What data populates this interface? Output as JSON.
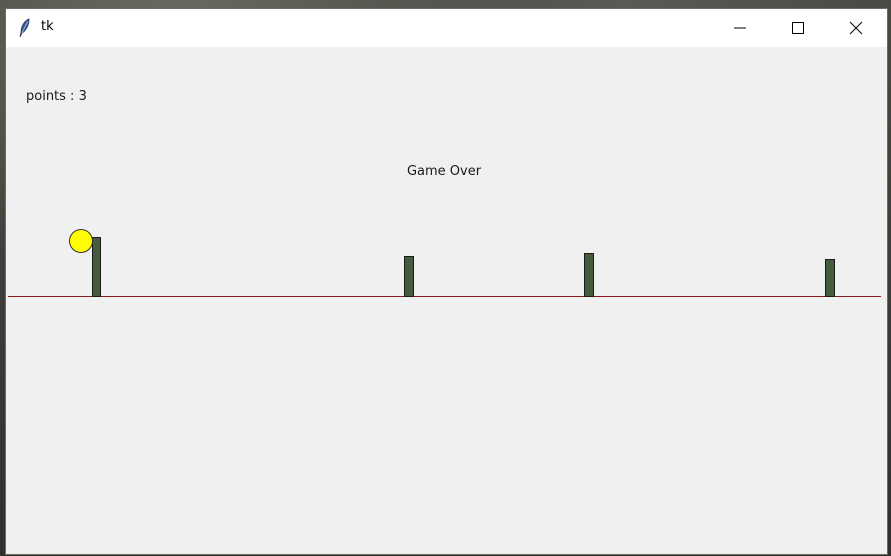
{
  "window": {
    "title": "tk",
    "minimize_icon": "minimize-icon",
    "maximize_icon": "maximize-icon",
    "close_icon": "close-icon",
    "app_icon": "feather-icon"
  },
  "game": {
    "points_text": "points : 3",
    "status_text": "Game Over",
    "ball_color": "#ffff00",
    "obstacle_color": "#445c3c",
    "ground_color": "#8b1a1a"
  }
}
